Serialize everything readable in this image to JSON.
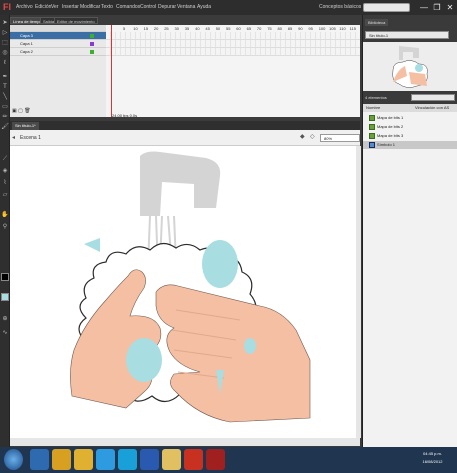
{
  "app": {
    "logo": "Fl",
    "menu": [
      "Archivo",
      "Edición",
      "Ver",
      "Insertar",
      "Modificar",
      "Texto",
      "Comandos",
      "Control",
      "Depurar",
      "Ventana",
      "Ayuda"
    ],
    "workspace": "Conceptos básicos",
    "window_buttons": [
      "—",
      "❐",
      "✕"
    ]
  },
  "timeline": {
    "tabs": [
      "Línea de tiempo",
      "Salida",
      "Editor de movimiento"
    ],
    "layers": [
      "Capa 3",
      "Capa 1",
      "Capa 2"
    ],
    "frame_numbers": [
      "5",
      "10",
      "15",
      "20",
      "25",
      "30",
      "35",
      "40",
      "45",
      "50",
      "55",
      "60",
      "65",
      "70",
      "75",
      "80",
      "85",
      "90",
      "95",
      "100",
      "105",
      "110",
      "115",
      "120"
    ],
    "status": "24.00 fps   0.0s"
  },
  "document": {
    "tab": "Sin título-1*",
    "scene": "Escena 1",
    "zoom": "80%"
  },
  "library": {
    "title": "Biblioteca",
    "doc": "Sin título-1",
    "count": "4 elementos",
    "columns": [
      "Nombre",
      "Vinculación con AS"
    ],
    "items": [
      "Mapa de bits 1",
      "Mapa de bits 2",
      "Mapa de bits 3",
      "Símbolo 1"
    ]
  },
  "taskbar": {
    "time": "04:45 p.m.",
    "date": "16/08/2012",
    "colors": {
      "taskbar": "#1f3550",
      "skin": "#f5bfa3",
      "drop": "#a8dde2",
      "foam": "#ffffff",
      "faucet": "#d4d4d4"
    }
  }
}
